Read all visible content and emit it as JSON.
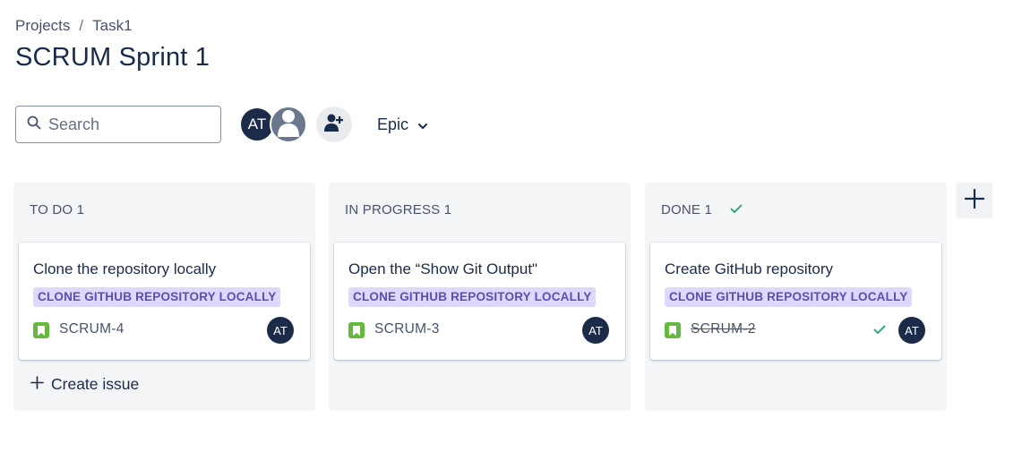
{
  "breadcrumb": {
    "items": [
      "Projects",
      "Task1"
    ],
    "separator": "/"
  },
  "page_title": "SCRUM Sprint 1",
  "toolbar": {
    "search_placeholder": "Search",
    "avatar_initials": "AT",
    "epic_filter_label": "Epic",
    "icons": [
      "search-icon",
      "person-icon",
      "add-person-icon",
      "chevron-down-icon"
    ]
  },
  "columns": [
    {
      "title": "TO DO 1",
      "card": {
        "title": "Clone the repository locally",
        "epic": "CLONE GITHUB REPOSITORY LOCALLY",
        "key": "SCRUM-4",
        "assignee": "AT",
        "done": false
      },
      "create_label": "Create issue"
    },
    {
      "title": "IN PROGRESS 1",
      "card": {
        "title": "Open the “Show Git Output\"",
        "epic": "CLONE GITHUB REPOSITORY LOCALLY",
        "key": "SCRUM-3",
        "assignee": "AT",
        "done": false
      }
    },
    {
      "title": "DONE 1",
      "card": {
        "title": "Create GitHub repository",
        "epic": "CLONE GITHUB REPOSITORY LOCALLY",
        "key": "SCRUM-2",
        "assignee": "AT",
        "done": true
      }
    }
  ],
  "colors": {
    "story_icon": "#63ba3c",
    "epic_lozenge_bg": "#dfd8fd",
    "epic_lozenge_text": "#5e4db2",
    "done_check": "#22a06b",
    "avatar_bg": "#1d2b4a"
  }
}
